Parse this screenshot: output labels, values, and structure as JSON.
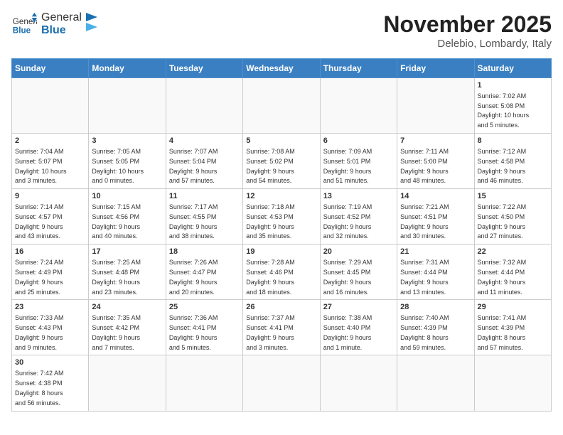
{
  "header": {
    "logo_general": "General",
    "logo_blue": "Blue",
    "title": "November 2025",
    "location": "Delebio, Lombardy, Italy"
  },
  "weekdays": [
    "Sunday",
    "Monday",
    "Tuesday",
    "Wednesday",
    "Thursday",
    "Friday",
    "Saturday"
  ],
  "weeks": [
    [
      {
        "day": "",
        "info": ""
      },
      {
        "day": "",
        "info": ""
      },
      {
        "day": "",
        "info": ""
      },
      {
        "day": "",
        "info": ""
      },
      {
        "day": "",
        "info": ""
      },
      {
        "day": "",
        "info": ""
      },
      {
        "day": "1",
        "info": "Sunrise: 7:02 AM\nSunset: 5:08 PM\nDaylight: 10 hours\nand 5 minutes."
      }
    ],
    [
      {
        "day": "2",
        "info": "Sunrise: 7:04 AM\nSunset: 5:07 PM\nDaylight: 10 hours\nand 3 minutes."
      },
      {
        "day": "3",
        "info": "Sunrise: 7:05 AM\nSunset: 5:05 PM\nDaylight: 10 hours\nand 0 minutes."
      },
      {
        "day": "4",
        "info": "Sunrise: 7:07 AM\nSunset: 5:04 PM\nDaylight: 9 hours\nand 57 minutes."
      },
      {
        "day": "5",
        "info": "Sunrise: 7:08 AM\nSunset: 5:02 PM\nDaylight: 9 hours\nand 54 minutes."
      },
      {
        "day": "6",
        "info": "Sunrise: 7:09 AM\nSunset: 5:01 PM\nDaylight: 9 hours\nand 51 minutes."
      },
      {
        "day": "7",
        "info": "Sunrise: 7:11 AM\nSunset: 5:00 PM\nDaylight: 9 hours\nand 48 minutes."
      },
      {
        "day": "8",
        "info": "Sunrise: 7:12 AM\nSunset: 4:58 PM\nDaylight: 9 hours\nand 46 minutes."
      }
    ],
    [
      {
        "day": "9",
        "info": "Sunrise: 7:14 AM\nSunset: 4:57 PM\nDaylight: 9 hours\nand 43 minutes."
      },
      {
        "day": "10",
        "info": "Sunrise: 7:15 AM\nSunset: 4:56 PM\nDaylight: 9 hours\nand 40 minutes."
      },
      {
        "day": "11",
        "info": "Sunrise: 7:17 AM\nSunset: 4:55 PM\nDaylight: 9 hours\nand 38 minutes."
      },
      {
        "day": "12",
        "info": "Sunrise: 7:18 AM\nSunset: 4:53 PM\nDaylight: 9 hours\nand 35 minutes."
      },
      {
        "day": "13",
        "info": "Sunrise: 7:19 AM\nSunset: 4:52 PM\nDaylight: 9 hours\nand 32 minutes."
      },
      {
        "day": "14",
        "info": "Sunrise: 7:21 AM\nSunset: 4:51 PM\nDaylight: 9 hours\nand 30 minutes."
      },
      {
        "day": "15",
        "info": "Sunrise: 7:22 AM\nSunset: 4:50 PM\nDaylight: 9 hours\nand 27 minutes."
      }
    ],
    [
      {
        "day": "16",
        "info": "Sunrise: 7:24 AM\nSunset: 4:49 PM\nDaylight: 9 hours\nand 25 minutes."
      },
      {
        "day": "17",
        "info": "Sunrise: 7:25 AM\nSunset: 4:48 PM\nDaylight: 9 hours\nand 23 minutes."
      },
      {
        "day": "18",
        "info": "Sunrise: 7:26 AM\nSunset: 4:47 PM\nDaylight: 9 hours\nand 20 minutes."
      },
      {
        "day": "19",
        "info": "Sunrise: 7:28 AM\nSunset: 4:46 PM\nDaylight: 9 hours\nand 18 minutes."
      },
      {
        "day": "20",
        "info": "Sunrise: 7:29 AM\nSunset: 4:45 PM\nDaylight: 9 hours\nand 16 minutes."
      },
      {
        "day": "21",
        "info": "Sunrise: 7:31 AM\nSunset: 4:44 PM\nDaylight: 9 hours\nand 13 minutes."
      },
      {
        "day": "22",
        "info": "Sunrise: 7:32 AM\nSunset: 4:44 PM\nDaylight: 9 hours\nand 11 minutes."
      }
    ],
    [
      {
        "day": "23",
        "info": "Sunrise: 7:33 AM\nSunset: 4:43 PM\nDaylight: 9 hours\nand 9 minutes."
      },
      {
        "day": "24",
        "info": "Sunrise: 7:35 AM\nSunset: 4:42 PM\nDaylight: 9 hours\nand 7 minutes."
      },
      {
        "day": "25",
        "info": "Sunrise: 7:36 AM\nSunset: 4:41 PM\nDaylight: 9 hours\nand 5 minutes."
      },
      {
        "day": "26",
        "info": "Sunrise: 7:37 AM\nSunset: 4:41 PM\nDaylight: 9 hours\nand 3 minutes."
      },
      {
        "day": "27",
        "info": "Sunrise: 7:38 AM\nSunset: 4:40 PM\nDaylight: 9 hours\nand 1 minute."
      },
      {
        "day": "28",
        "info": "Sunrise: 7:40 AM\nSunset: 4:39 PM\nDaylight: 8 hours\nand 59 minutes."
      },
      {
        "day": "29",
        "info": "Sunrise: 7:41 AM\nSunset: 4:39 PM\nDaylight: 8 hours\nand 57 minutes."
      }
    ],
    [
      {
        "day": "30",
        "info": "Sunrise: 7:42 AM\nSunset: 4:38 PM\nDaylight: 8 hours\nand 56 minutes."
      },
      {
        "day": "",
        "info": ""
      },
      {
        "day": "",
        "info": ""
      },
      {
        "day": "",
        "info": ""
      },
      {
        "day": "",
        "info": ""
      },
      {
        "day": "",
        "info": ""
      },
      {
        "day": "",
        "info": ""
      }
    ]
  ]
}
